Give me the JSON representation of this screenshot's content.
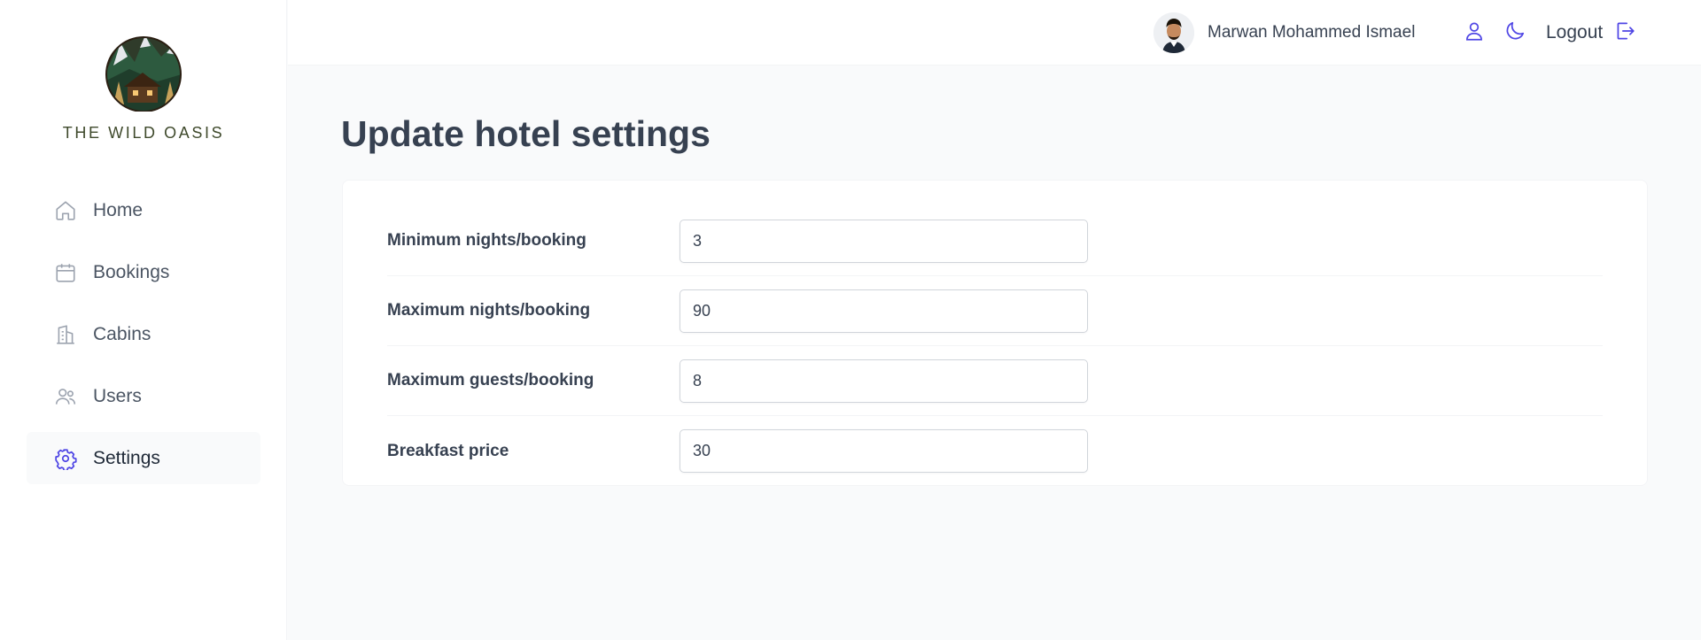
{
  "brand": {
    "name": "THE WILD OASIS"
  },
  "nav": {
    "items": [
      {
        "label": "Home",
        "icon": "home-icon",
        "active": false
      },
      {
        "label": "Bookings",
        "icon": "calendar-icon",
        "active": false
      },
      {
        "label": "Cabins",
        "icon": "building-icon",
        "active": false
      },
      {
        "label": "Users",
        "icon": "users-icon",
        "active": false
      },
      {
        "label": "Settings",
        "icon": "gear-icon",
        "active": true
      }
    ]
  },
  "header": {
    "user_name": "Marwan Mohammed Ismael",
    "logout_label": "Logout",
    "icons": [
      "user-icon",
      "moon-icon",
      "logout-icon"
    ]
  },
  "page": {
    "title": "Update hotel settings"
  },
  "settings": {
    "fields": [
      {
        "label": "Minimum nights/booking",
        "value": "3"
      },
      {
        "label": "Maximum nights/booking",
        "value": "90"
      },
      {
        "label": "Maximum guests/booking",
        "value": "8"
      },
      {
        "label": "Breakfast price",
        "value": "30"
      }
    ]
  },
  "colors": {
    "accent": "#4f46e5",
    "text": "#374151",
    "muted_icon": "#9ca3af",
    "background": "#f9fafb"
  }
}
